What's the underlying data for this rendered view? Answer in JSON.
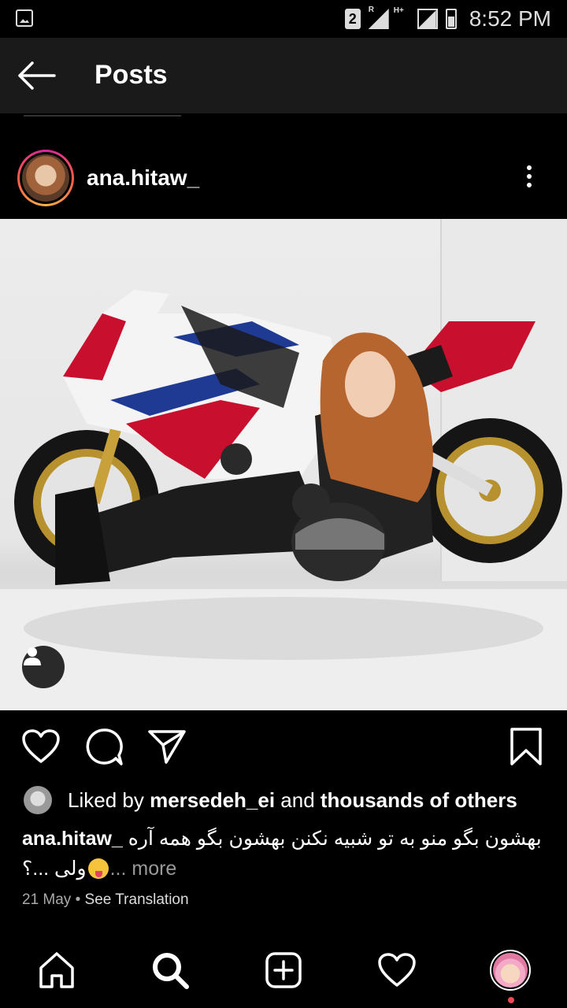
{
  "status_bar": {
    "sim_number": "2",
    "signal_label_1": "R",
    "signal_label_2": "H+",
    "time": "8:52 PM"
  },
  "header": {
    "title": "Posts",
    "back_icon": "arrow-left-icon"
  },
  "post": {
    "username": "ana.hitaw_",
    "more_icon": "kebab-menu-icon",
    "photo_description_icon": "user-tag-icon"
  },
  "actions": {
    "like_icon": "heart-icon",
    "comment_icon": "comment-icon",
    "share_icon": "paper-plane-icon",
    "save_icon": "bookmark-icon"
  },
  "likes": {
    "prefix": "Liked by ",
    "user": "mersedeh_ei",
    "middle": " and ",
    "others": "thousands of others"
  },
  "caption": {
    "username": "ana.hitaw_",
    "text_line1": "بهشون بگو منو به تو شبیه نکنن بهشون بگو همه آره",
    "text_line2": "ولی ...؟",
    "more": " ... more"
  },
  "meta": {
    "date": "21 May",
    "separator": " • ",
    "translate": "See Translation"
  },
  "bottom_nav": {
    "items": [
      "home-icon",
      "search-icon",
      "add-post-icon",
      "activity-heart-icon",
      "profile-avatar"
    ]
  },
  "colors": {
    "background": "#000000",
    "header": "#1a1a1a",
    "notification_dot": "#ed4956"
  }
}
